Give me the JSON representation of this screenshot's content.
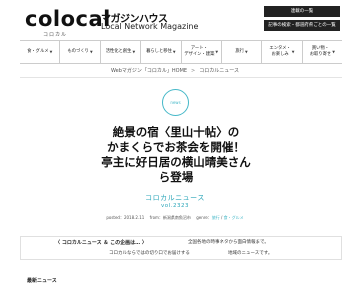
{
  "header": {
    "logo": "colocal",
    "logo_sub": "コロカル",
    "brand_jp": "マガジンハウス",
    "brand_en": "Local Network Magazine",
    "button_top": "連載の一覧",
    "button_bottom": "記事の検索・都道府県ごとの一覧"
  },
  "nav": {
    "items": [
      {
        "label": "食・グルメ"
      },
      {
        "label": "ものづくり"
      },
      {
        "label": "活性化と創生"
      },
      {
        "label": "暮らしと移住"
      },
      {
        "label": "アート・\nデザイン・建築"
      },
      {
        "label": "旅行"
      },
      {
        "label": "エンタメ・\nお楽しみ"
      },
      {
        "label": "買い物・\nお取り寄せ"
      }
    ],
    "caret": "▼"
  },
  "breadcrumb": {
    "home": "Webマガジン「コロカル」HOME",
    "sep": ">",
    "current": "コロカルニュース"
  },
  "article": {
    "badge": "news",
    "title": "絶景の宿〈里山十帖〉の\nかまくらでお茶会を開催！\n亭主に好日居の横山晴美さん\nら登場",
    "series_name": "コロカルニュース",
    "series_vol": "vol.2323",
    "meta": {
      "posted_label": "posted：",
      "posted": "2018.2.11",
      "from_label": "from：",
      "from": "新潟県南魚沼市",
      "genre_label": "genre：",
      "genre_a": "旅行",
      "genre_sep": " / ",
      "genre_b": "食・グルメ"
    }
  },
  "intro": {
    "left_title": "〈 コロカルニュース ＆ この企画は… 〉",
    "left_sub": "コロカルならではの切り口でお届けする",
    "right_line1": "全国各地の時事ネタから面白情報まで。",
    "right_line2": "地域のニュースです。"
  },
  "sidebar": {
    "latest": "最新ニュース"
  }
}
